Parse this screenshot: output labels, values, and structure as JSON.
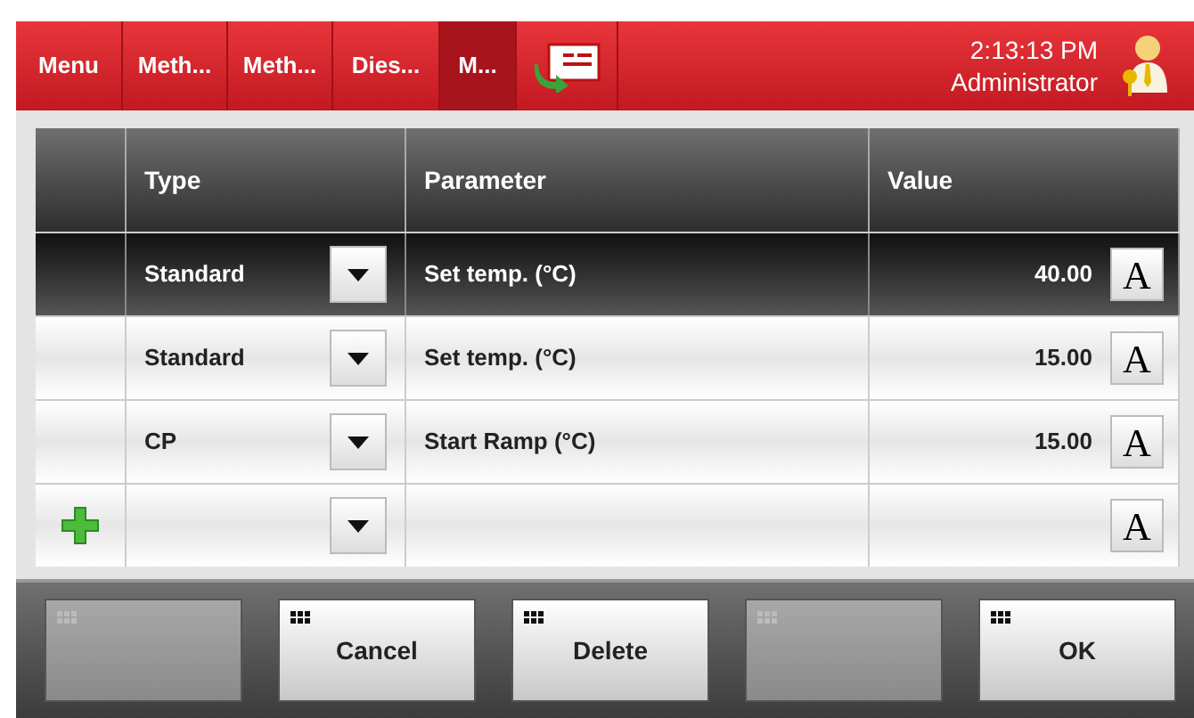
{
  "tabs": [
    {
      "label": "Menu",
      "selected": false
    },
    {
      "label": "Meth...",
      "selected": false
    },
    {
      "label": "Meth...",
      "selected": false
    },
    {
      "label": "Dies...",
      "selected": false
    },
    {
      "label": "M...",
      "selected": true
    }
  ],
  "header": {
    "time": "2:13:13 PM",
    "user": "Administrator"
  },
  "table": {
    "columns": [
      "Type",
      "Parameter",
      "Value"
    ],
    "rows": [
      {
        "type": "Standard",
        "parameter": "Set temp. (°C)",
        "value": "40.00",
        "key": "A",
        "selected": true,
        "kind": "entry"
      },
      {
        "type": "Standard",
        "parameter": "Set temp. (°C)",
        "value": "15.00",
        "key": "A",
        "selected": false,
        "kind": "entry"
      },
      {
        "type": "CP",
        "parameter": "Start Ramp (°C)",
        "value": "15.00",
        "key": "A",
        "selected": false,
        "kind": "entry"
      },
      {
        "key": "A",
        "selected": false,
        "kind": "add"
      }
    ]
  },
  "buttons": [
    {
      "disabled": true
    },
    {
      "label": "Cancel",
      "disabled": false
    },
    {
      "label": "Delete",
      "disabled": false
    },
    {
      "disabled": true
    },
    {
      "label": "OK",
      "disabled": false
    }
  ]
}
